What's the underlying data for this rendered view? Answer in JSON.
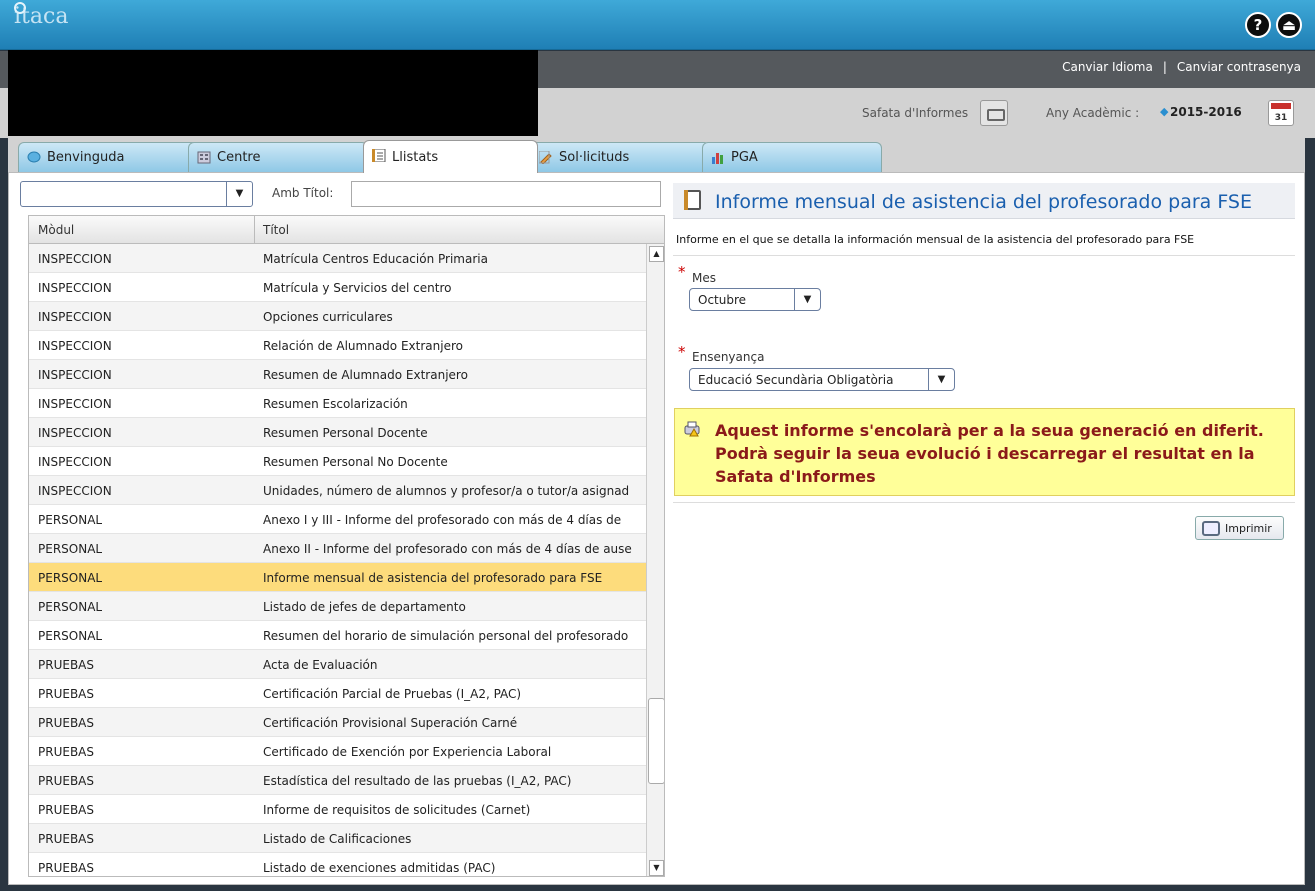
{
  "app": {
    "logo": "itaca"
  },
  "header": {
    "help_icon": "?",
    "exit_icon": "⏏",
    "links": [
      "Canviar Idioma",
      "Canviar contrasenya"
    ],
    "separator": "|"
  },
  "infobar": {
    "safata_label": "Safata d'Informes",
    "any_label": "Any Acadèmic :",
    "any_value": "2015-2016",
    "calendar_day": "31"
  },
  "tabs": [
    {
      "label": "Benvinguda"
    },
    {
      "label": "Centre"
    },
    {
      "label": "Llistats"
    },
    {
      "label": "Sol·licituds"
    },
    {
      "label": "PGA"
    }
  ],
  "filter": {
    "select_value": "",
    "arrow": "▼",
    "title_label": "Amb Títol:",
    "title_value": ""
  },
  "grid": {
    "columns": [
      "Mòdul",
      "Títol"
    ],
    "rows": [
      {
        "mod": "INSPECCION",
        "title": "Matrícula Centros Educación Primaria"
      },
      {
        "mod": "INSPECCION",
        "title": "Matrícula y Servicios del centro"
      },
      {
        "mod": "INSPECCION",
        "title": "Opciones curriculares"
      },
      {
        "mod": "INSPECCION",
        "title": "Relación de Alumnado Extranjero"
      },
      {
        "mod": "INSPECCION",
        "title": "Resumen de Alumnado Extranjero"
      },
      {
        "mod": "INSPECCION",
        "title": "Resumen Escolarización"
      },
      {
        "mod": "INSPECCION",
        "title": "Resumen Personal Docente"
      },
      {
        "mod": "INSPECCION",
        "title": "Resumen Personal No Docente"
      },
      {
        "mod": "INSPECCION",
        "title": "Unidades, número de alumnos y profesor/a o tutor/a asignad"
      },
      {
        "mod": "PERSONAL",
        "title": "Anexo I y III -  Informe del profesorado con más de 4 días de"
      },
      {
        "mod": "PERSONAL",
        "title": "Anexo II - Informe del profesorado con más de 4 días de ause"
      },
      {
        "mod": "PERSONAL",
        "title": "Informe mensual de asistencia del profesorado para FSE"
      },
      {
        "mod": "PERSONAL",
        "title": "Listado de jefes de departamento"
      },
      {
        "mod": "PERSONAL",
        "title": "Resumen del horario de simulación personal del profesorado"
      },
      {
        "mod": "PRUEBAS",
        "title": "Acta de Evaluación"
      },
      {
        "mod": "PRUEBAS",
        "title": "Certificación Parcial de Pruebas (I_A2, PAC)"
      },
      {
        "mod": "PRUEBAS",
        "title": "Certificación Provisional Superación Carné"
      },
      {
        "mod": "PRUEBAS",
        "title": "Certificado de Exención por Experiencia Laboral"
      },
      {
        "mod": "PRUEBAS",
        "title": "Estadística del resultado de las pruebas (I_A2, PAC)"
      },
      {
        "mod": "PRUEBAS",
        "title": "Informe de requisitos de solicitudes (Carnet)"
      },
      {
        "mod": "PRUEBAS",
        "title": "Listado de Calificaciones"
      },
      {
        "mod": "PRUEBAS",
        "title": "Listado de exenciones admitidas (PAC)"
      }
    ],
    "selected_index": 11,
    "scroll_up": "▲",
    "scroll_down": "▼"
  },
  "report": {
    "title": "Informe mensual de asistencia del profesorado para FSE",
    "description": "Informe en el que se detalla la información mensual de la asistencia del profesorado para FSE",
    "required_mark": "*",
    "mes_label": "Mes",
    "mes_value": "Octubre",
    "ensenyanca_label": "Ensenyança",
    "ensenyanca_value": "Educació Secundària Obligatòria",
    "warning": "Aquest informe s'encolarà per a la seua generació en diferit. Podrà seguir la seua evolució i descarregar el resultat en la Safata d'Informes",
    "print_label": "Imprimir"
  },
  "colors": {
    "header_blue": "#1f7fb5",
    "title_blue": "#1a5fae",
    "selected_row": "#fddc7c",
    "warning_bg": "#ffff99",
    "warning_text": "#8b1a1a"
  }
}
